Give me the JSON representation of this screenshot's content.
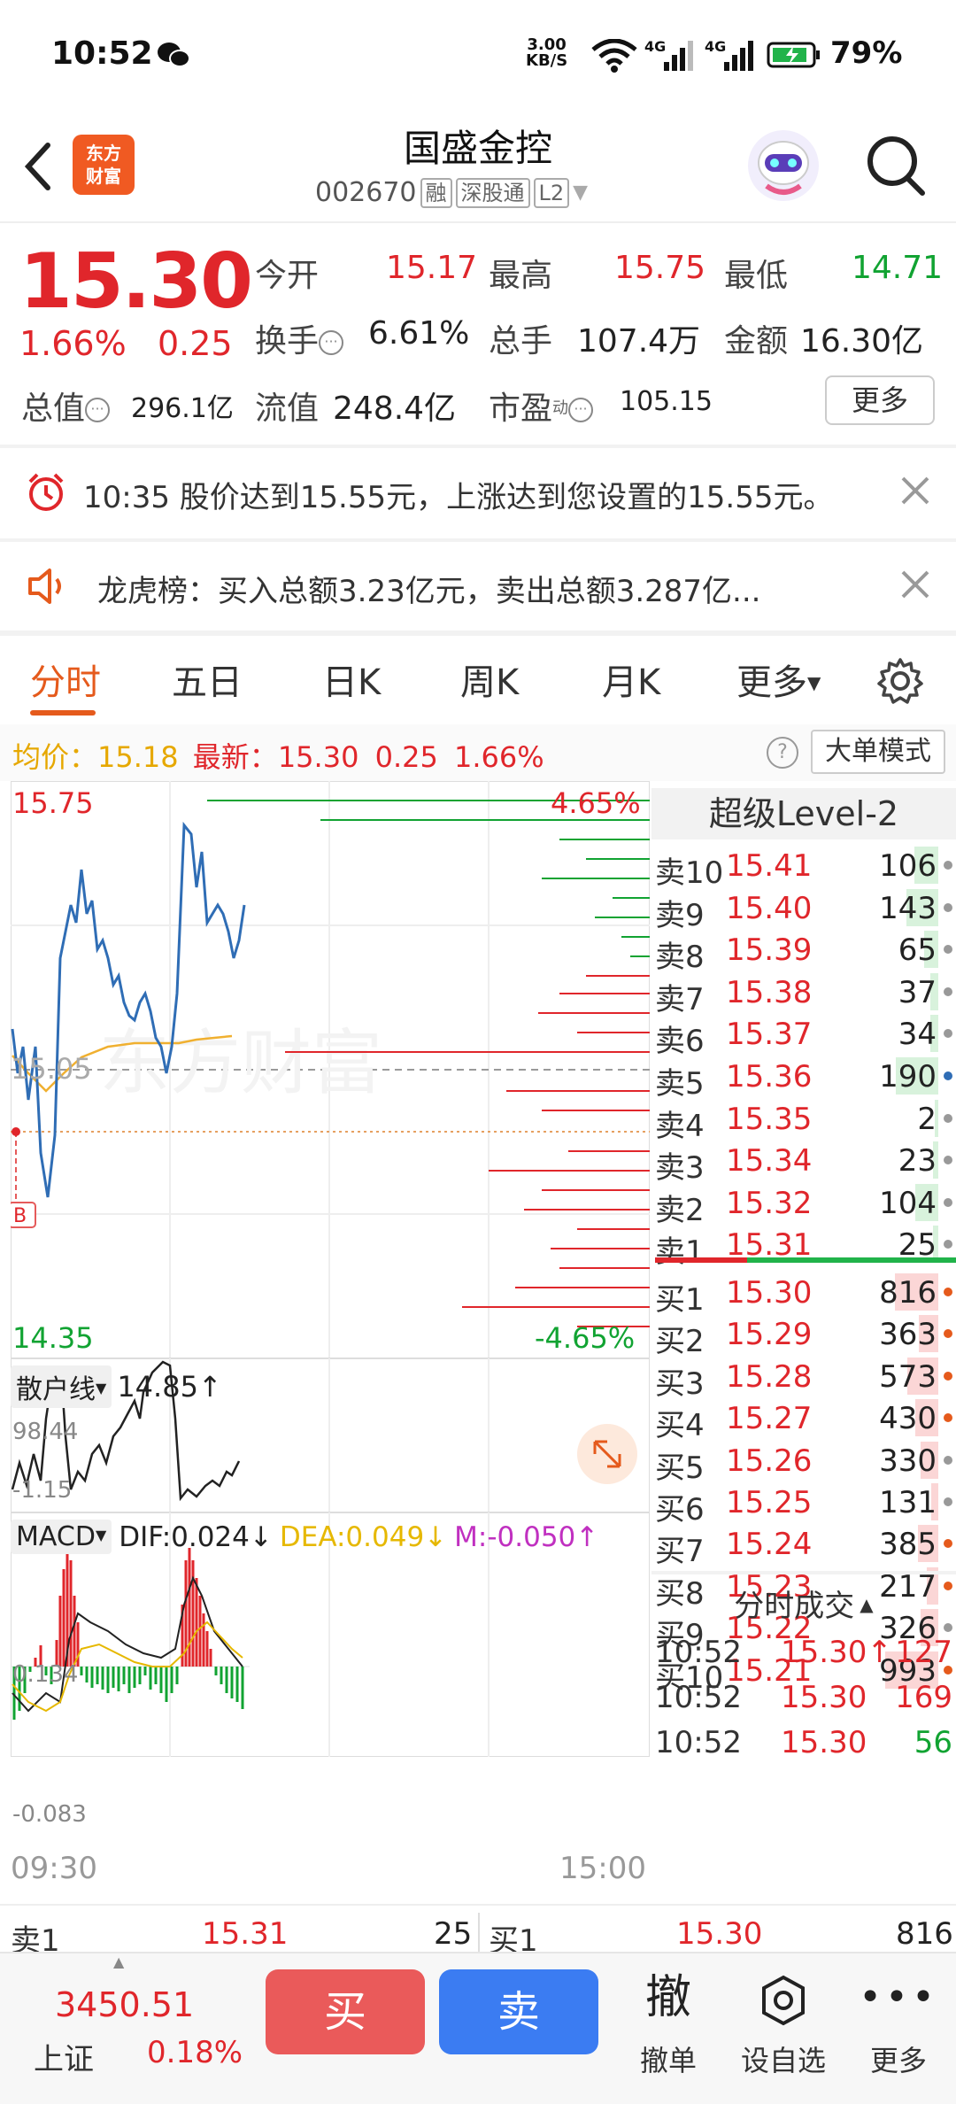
{
  "status": {
    "time": "10:52",
    "speed_top": "3.00",
    "speed_bottom": "KB/S",
    "net1": "4G",
    "net2": "4G",
    "battery": "79%"
  },
  "header": {
    "logo_line1": "东方",
    "logo_line2": "财富",
    "stock_name": "国盛金控",
    "stock_code": "002670",
    "tags": [
      "融",
      "深股通",
      "L2"
    ]
  },
  "quote": {
    "price": "15.30",
    "change_pct": "1.66%",
    "change": "0.25",
    "open_label": "今开",
    "open": "15.17",
    "high_label": "最高",
    "high": "15.75",
    "low_label": "最低",
    "low": "14.71",
    "turnover_label": "换手",
    "turnover": "6.61%",
    "volume_label": "总手",
    "volume": "107.4万",
    "amount_label": "金额",
    "amount": "16.30亿",
    "mktcap_label": "总值",
    "mktcap": "296.1亿",
    "float_label": "流值",
    "float": "248.4亿",
    "pe_label": "市盈",
    "pe_sup": "动",
    "pe": "105.15",
    "more": "更多"
  },
  "notices": {
    "alert": "10:35 股价达到15.55元，上涨达到您设置的15.55元。",
    "dragon": "龙虎榜：买入总额3.23亿元，卖出总额3.287亿..."
  },
  "tabs": [
    "分时",
    "五日",
    "日K",
    "周K",
    "月K",
    "更多"
  ],
  "avgbar": {
    "avg_label": "均价：",
    "avg": "15.18",
    "latest_label": "最新：",
    "latest": "15.30",
    "chg": "0.25",
    "pct": "1.66%",
    "help": "?",
    "mode": "大单模式"
  },
  "chart": {
    "price_high": "15.75",
    "price_low": "14.35",
    "pct_high": "4.65%",
    "pct_low": "-4.65%",
    "mid": "15.05",
    "watermark": "东方财富",
    "b_marker": "B",
    "retail_label": "散户线",
    "retail_value": "14.85↑",
    "retail_max": "98.44",
    "retail_min": "-1.15",
    "macd_label": "MACD",
    "dif": "DIF:0.024↓",
    "dea": "DEA:0.049↓",
    "m": "M:-0.050↑",
    "macd_max": "0.134",
    "macd_min": "-0.083",
    "time_start": "09:30",
    "time_end": "15:00",
    "colors": {
      "price": "#2f6db5",
      "avg": "#f0b030",
      "up": "#e0262b",
      "down": "#11a332",
      "dea": "#e6b800",
      "m": "#c030c0"
    }
  },
  "book": {
    "title": "超级Level-2",
    "asks": [
      {
        "label": "卖10",
        "price": "15.41",
        "vol": "106"
      },
      {
        "label": "卖9",
        "price": "15.40",
        "vol": "143"
      },
      {
        "label": "卖8",
        "price": "15.39",
        "vol": "65"
      },
      {
        "label": "卖7",
        "price": "15.38",
        "vol": "37"
      },
      {
        "label": "卖6",
        "price": "15.37",
        "vol": "34"
      },
      {
        "label": "卖5",
        "price": "15.36",
        "vol": "190"
      },
      {
        "label": "卖4",
        "price": "15.35",
        "vol": "2"
      },
      {
        "label": "卖3",
        "price": "15.34",
        "vol": "23"
      },
      {
        "label": "卖2",
        "price": "15.32",
        "vol": "104"
      },
      {
        "label": "卖1",
        "price": "15.31",
        "vol": "25"
      }
    ],
    "bids": [
      {
        "label": "买1",
        "price": "15.30",
        "vol": "816"
      },
      {
        "label": "买2",
        "price": "15.29",
        "vol": "363"
      },
      {
        "label": "买3",
        "price": "15.28",
        "vol": "573"
      },
      {
        "label": "买4",
        "price": "15.27",
        "vol": "430"
      },
      {
        "label": "买5",
        "price": "15.26",
        "vol": "330"
      },
      {
        "label": "买6",
        "price": "15.25",
        "vol": "131"
      },
      {
        "label": "买7",
        "price": "15.24",
        "vol": "385"
      },
      {
        "label": "买8",
        "price": "15.23",
        "vol": "217"
      },
      {
        "label": "买9",
        "price": "15.22",
        "vol": "326"
      },
      {
        "label": "买10",
        "price": "15.21",
        "vol": "993"
      }
    ],
    "trades_title": "分时成交",
    "trades": [
      {
        "time": "10:52",
        "price": "15.30↑",
        "vol": "127"
      },
      {
        "time": "10:52",
        "price": "15.30",
        "vol": "169"
      },
      {
        "time": "10:52",
        "price": "15.30",
        "vol": "56"
      }
    ]
  },
  "strip": {
    "sell_label": "卖1",
    "sell_price": "15.31",
    "sell_vol": "25",
    "buy_label": "买1",
    "buy_price": "15.30",
    "buy_vol": "816"
  },
  "nav": {
    "index_value": "3450.51",
    "index_name": "上证",
    "index_pct": "0.18%",
    "buy": "买",
    "sell": "卖",
    "cancel_icon": "撤",
    "cancel": "撤单",
    "watch": "设自选",
    "more": "更多"
  }
}
